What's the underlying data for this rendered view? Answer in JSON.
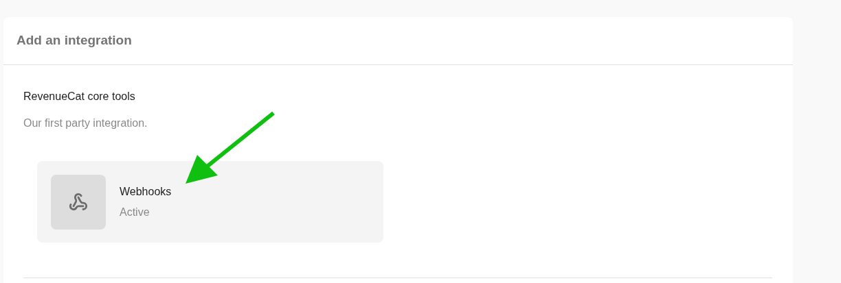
{
  "panel": {
    "title": "Add an integration"
  },
  "section": {
    "title": "RevenueCat core tools",
    "subtitle": "Our first party integration."
  },
  "integrations": [
    {
      "name": "Webhooks",
      "status": "Active"
    }
  ],
  "annotation": {
    "kind": "arrow"
  }
}
